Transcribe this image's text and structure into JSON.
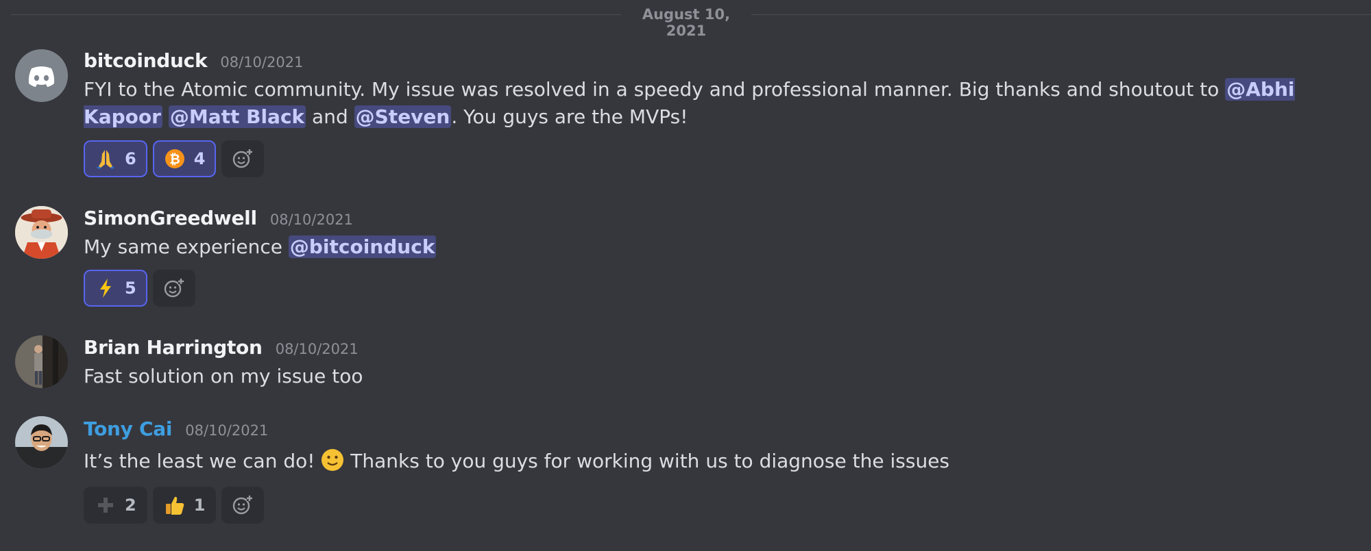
{
  "divider": {
    "date": "August 10, 2021"
  },
  "messages": [
    {
      "username": "bitcoinduck",
      "timestamp": "08/10/2021",
      "text_parts": [
        "FYI to the Atomic community. My issue was resolved in a speedy and professional manner. Big thanks and shoutout to ",
        "@Abhi Kapoor",
        " ",
        "@Matt Black",
        " and ",
        "@Steven",
        ". You guys are the MVPs!"
      ],
      "avatar": "discord-logo-icon",
      "reactions": [
        {
          "emoji": "folded-hands-icon",
          "count": "6",
          "selected": true
        },
        {
          "emoji": "bitcoin-icon",
          "count": "4",
          "selected": true
        }
      ]
    },
    {
      "username": "SimonGreedwell",
      "timestamp": "08/10/2021",
      "text_parts": [
        "My same experience ",
        "@bitcoinduck"
      ],
      "avatar": "cartoon-cowboy-avatar",
      "reactions": [
        {
          "emoji": "high-voltage-icon",
          "count": "5",
          "selected": true
        }
      ]
    },
    {
      "username": "Brian Harrington",
      "timestamp": "08/10/2021",
      "text_parts": [
        "Fast solution on my issue too"
      ],
      "avatar": "photo-avatar"
    },
    {
      "username": "Tony Cai",
      "username_color": "#3e9ee0",
      "timestamp": "08/10/2021",
      "text_parts": [
        "It’s the least we can do! ",
        " Thanks to you guys for working with us to diagnose the issues"
      ],
      "avatar": "photo-avatar",
      "reactions": [
        {
          "emoji": "plus-icon",
          "count": "2",
          "selected": false
        },
        {
          "emoji": "thumbs-up-icon",
          "count": "1",
          "selected": false
        }
      ]
    }
  ],
  "colors": {
    "background": "#36373d",
    "mention_bg": "#464a7e",
    "mention_text": "#c9cdfb",
    "reaction_selected_border": "#5865f2",
    "staff_name": "#3e9ee0"
  }
}
